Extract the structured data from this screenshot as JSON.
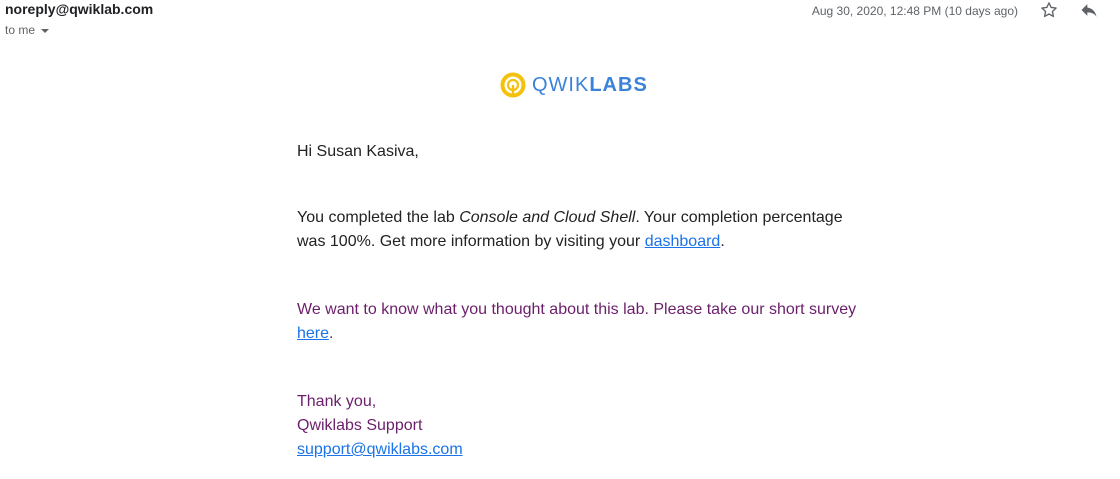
{
  "header": {
    "sender": "noreply@qwiklab.com",
    "recipient": "to me",
    "date": "Aug 30, 2020, 12:48 PM (10 days ago)"
  },
  "icons": {
    "star": "star-outline-icon",
    "reply": "reply-icon",
    "caret": "caret-down-icon",
    "logo_mark": "qwiklabs-logo-icon"
  },
  "logo": {
    "text_light": "QWIK",
    "text_bold": "LABS",
    "colors": {
      "mark_outer": "#f4c20d",
      "text": "#3b82d9"
    }
  },
  "body": {
    "greeting": "Hi Susan Kasiva,",
    "completion_pre": "You completed the lab ",
    "lab_name": "Console and Cloud Shell",
    "completion_mid": ". Your completion percentage was 100%. Get more information by visiting your ",
    "dashboard_link": "dashboard",
    "completion_end": ".",
    "survey_pre": "We want to know what you thought about this lab. Please take our short survey ",
    "survey_link": "here",
    "survey_end": ".",
    "sign_thanks": "Thank you,",
    "sign_name": "Qwiklabs Support",
    "sign_email": "support@qwiklabs.com"
  },
  "colors": {
    "link": "#1a73e8",
    "survey_text": "#6b1f6b",
    "body_text": "#222222",
    "meta_text": "#5f6368"
  }
}
